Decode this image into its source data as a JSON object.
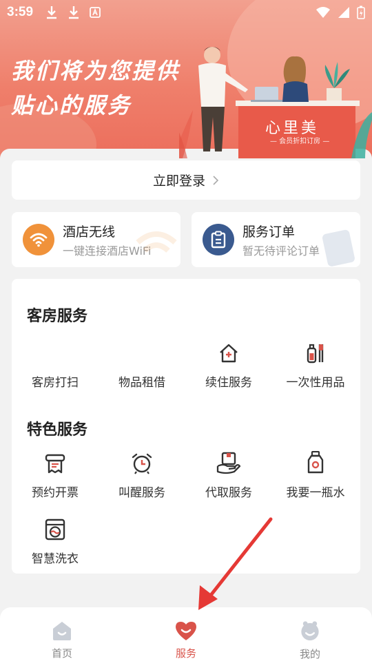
{
  "status_bar": {
    "time": "3:59"
  },
  "banner": {
    "title_line1": "我们将为您提供",
    "title_line2": "贴心的服务",
    "brand": "心里美",
    "brand_sub": "— 会员折扣订房 —"
  },
  "login": {
    "label": "立即登录"
  },
  "quick": {
    "wifi": {
      "title": "酒店无线",
      "subtitle": "一键连接酒店WiFi",
      "icon": "wifi-icon",
      "color": "#f0923a"
    },
    "order": {
      "title": "服务订单",
      "subtitle": "暂无待评论订单",
      "icon": "clipboard-icon",
      "color": "#3a5a8f"
    }
  },
  "room_services": {
    "title": "客房服务",
    "items": [
      {
        "label": "客房打扫",
        "icon": "cleaning-icon"
      },
      {
        "label": "物品租借",
        "icon": "rent-icon"
      },
      {
        "label": "续住服务",
        "icon": "house-plus-icon"
      },
      {
        "label": "一次性用品",
        "icon": "toiletries-icon"
      }
    ]
  },
  "special_services": {
    "title": "特色服务",
    "items": [
      {
        "label": "预约开票",
        "icon": "receipt-icon"
      },
      {
        "label": "叫醒服务",
        "icon": "alarm-clock-icon"
      },
      {
        "label": "代取服务",
        "icon": "hand-box-icon"
      },
      {
        "label": "我要一瓶水",
        "icon": "water-bottle-icon"
      },
      {
        "label": "智慧洗衣",
        "icon": "washing-machine-icon"
      }
    ]
  },
  "nav": {
    "items": [
      {
        "label": "首页",
        "icon": "home-icon"
      },
      {
        "label": "服务",
        "icon": "heart-icon"
      },
      {
        "label": "我的",
        "icon": "profile-icon"
      }
    ],
    "active_color": "#d9534a"
  },
  "colors": {
    "accent": "#d9534a",
    "banner": "#ef7f6b"
  }
}
